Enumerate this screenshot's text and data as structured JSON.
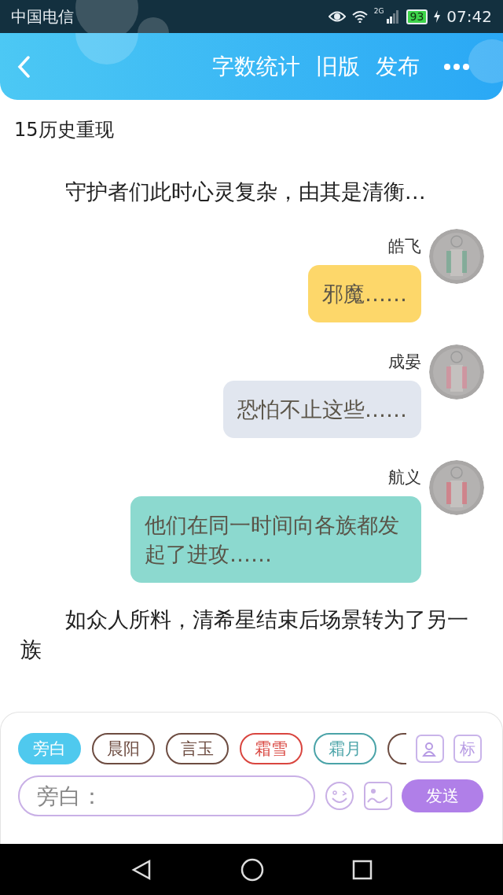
{
  "status_bar": {
    "carrier": "中国电信",
    "network": "2G",
    "battery": "93",
    "time": "07:42"
  },
  "header": {
    "actions": [
      "字数统计",
      "旧版",
      "发布"
    ]
  },
  "chapter_title": "15历史重现",
  "story": [
    {
      "kind": "narration",
      "text": "守护者们此时心灵复杂，由其是清衡…"
    },
    {
      "kind": "message",
      "name": "皓飞",
      "text": "邪魔……",
      "color": "#fdd76a"
    },
    {
      "kind": "message",
      "name": "成晏",
      "text": "恐怕不止这些……",
      "color": "#e1e6ef"
    },
    {
      "kind": "message",
      "name": "航义",
      "text": "他们在同一时间向各族都发起了进攻……",
      "color": "#8cd9cf"
    },
    {
      "kind": "narration",
      "text": "如众人所料，清希星结束后场景转为了另一族"
    }
  ],
  "roles": [
    {
      "label": "旁白",
      "color": "#4fc9ee",
      "selected": true
    },
    {
      "label": "晨阳",
      "color": "#6d4c41",
      "selected": false
    },
    {
      "label": "言玉",
      "color": "#6d4c41",
      "selected": false
    },
    {
      "label": "霜雪",
      "color": "#d9453f",
      "selected": false
    },
    {
      "label": "霜月",
      "color": "#4aa3a8",
      "selected": false
    },
    {
      "color": "#6d4c41",
      "selected": false
    }
  ],
  "composer": {
    "placeholder": "旁白：",
    "tag_button": "标",
    "send": "发送"
  }
}
